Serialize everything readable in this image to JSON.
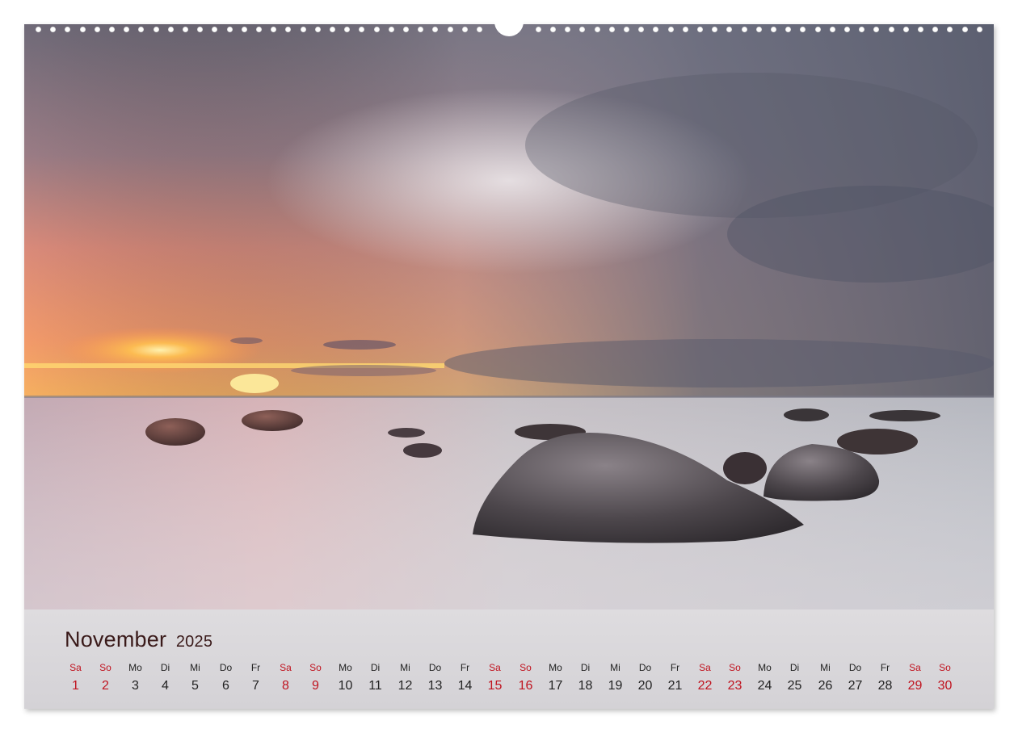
{
  "calendar": {
    "month": "November",
    "year": "2025",
    "weekend_color": "#c0131f",
    "days": [
      {
        "wd": "Sa",
        "n": "1",
        "we": true
      },
      {
        "wd": "So",
        "n": "2",
        "we": true
      },
      {
        "wd": "Mo",
        "n": "3",
        "we": false
      },
      {
        "wd": "Di",
        "n": "4",
        "we": false
      },
      {
        "wd": "Mi",
        "n": "5",
        "we": false
      },
      {
        "wd": "Do",
        "n": "6",
        "we": false
      },
      {
        "wd": "Fr",
        "n": "7",
        "we": false
      },
      {
        "wd": "Sa",
        "n": "8",
        "we": true
      },
      {
        "wd": "So",
        "n": "9",
        "we": true
      },
      {
        "wd": "Mo",
        "n": "10",
        "we": false
      },
      {
        "wd": "Di",
        "n": "11",
        "we": false
      },
      {
        "wd": "Mi",
        "n": "12",
        "we": false
      },
      {
        "wd": "Do",
        "n": "13",
        "we": false
      },
      {
        "wd": "Fr",
        "n": "14",
        "we": false
      },
      {
        "wd": "Sa",
        "n": "15",
        "we": true
      },
      {
        "wd": "So",
        "n": "16",
        "we": true
      },
      {
        "wd": "Mo",
        "n": "17",
        "we": false
      },
      {
        "wd": "Di",
        "n": "18",
        "we": false
      },
      {
        "wd": "Mi",
        "n": "19",
        "we": false
      },
      {
        "wd": "Do",
        "n": "20",
        "we": false
      },
      {
        "wd": "Fr",
        "n": "21",
        "we": false
      },
      {
        "wd": "Sa",
        "n": "22",
        "we": true
      },
      {
        "wd": "So",
        "n": "23",
        "we": true
      },
      {
        "wd": "Mo",
        "n": "24",
        "we": false
      },
      {
        "wd": "Di",
        "n": "25",
        "we": false
      },
      {
        "wd": "Mi",
        "n": "26",
        "we": false
      },
      {
        "wd": "Do",
        "n": "27",
        "we": false
      },
      {
        "wd": "Fr",
        "n": "28",
        "we": false
      },
      {
        "wd": "Sa",
        "n": "29",
        "we": true
      },
      {
        "wd": "So",
        "n": "30",
        "we": true
      }
    ]
  }
}
